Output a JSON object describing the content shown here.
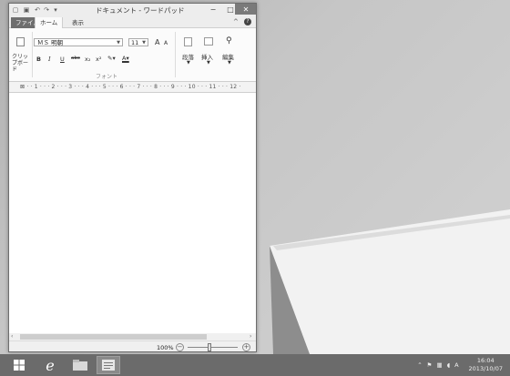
{
  "window": {
    "title": "ドキュメント - ワードパッド",
    "controls": {
      "minimize": "−",
      "maximize": "□",
      "close": "✕"
    }
  },
  "ribbon": {
    "tabs": [
      "ファイル",
      "ホーム",
      "表示"
    ],
    "clipboard_label": "クリップボード",
    "font_name": "ＭＳ 明朝",
    "font_size": "11",
    "font_group_label": "フォント",
    "paragraph_label": "段落",
    "insert_label": "挿入",
    "edit_label": "編集",
    "format_buttons": [
      "B",
      "I",
      "U",
      "abc",
      "x₂",
      "x²"
    ],
    "grow_font": "A",
    "shrink_font": "A"
  },
  "ruler": {
    "marks": "⊠ · · 1 · · · 2 · · · 3 · · · 4 · · · 5 · · · 6 · · · 7 · · · 8 · · · 9 · · · 10 · · · 11 · · · 12 ·"
  },
  "status": {
    "zoom_level": "100%",
    "zoom_out": "−",
    "zoom_in": "+"
  },
  "taskbar": {
    "clock_time": "16:04",
    "clock_date": "2013/10/07",
    "tray_ime": "A"
  }
}
